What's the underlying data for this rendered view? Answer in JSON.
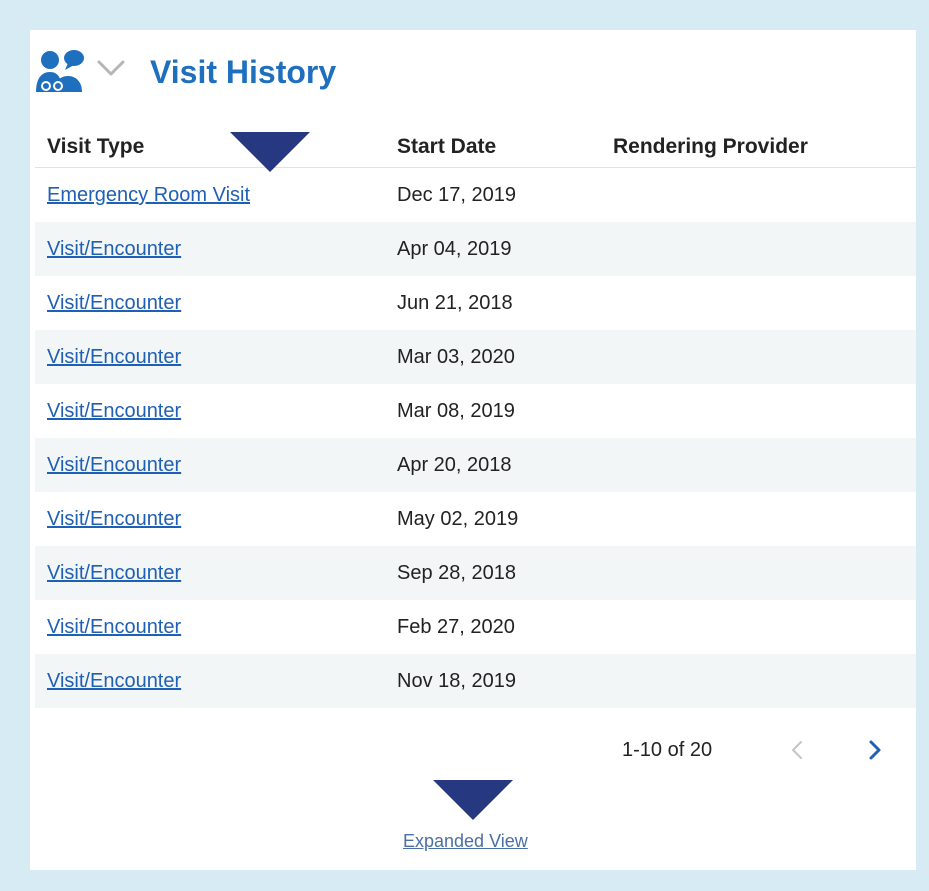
{
  "header": {
    "title": "Visit History",
    "icon": "people-chat-icon",
    "collapse_icon": "chevron-down-icon"
  },
  "table": {
    "columns": [
      "Visit Type",
      "Start Date",
      "Rendering Provider"
    ],
    "rows": [
      {
        "visit_type": "Emergency Room Visit",
        "start_date": "Dec 17, 2019",
        "provider": ""
      },
      {
        "visit_type": "Visit/Encounter",
        "start_date": "Apr 04, 2019",
        "provider": ""
      },
      {
        "visit_type": "Visit/Encounter",
        "start_date": "Jun 21, 2018",
        "provider": ""
      },
      {
        "visit_type": "Visit/Encounter",
        "start_date": "Mar 03, 2020",
        "provider": ""
      },
      {
        "visit_type": "Visit/Encounter",
        "start_date": "Mar 08, 2019",
        "provider": ""
      },
      {
        "visit_type": "Visit/Encounter",
        "start_date": "Apr 20, 2018",
        "provider": ""
      },
      {
        "visit_type": "Visit/Encounter",
        "start_date": "May 02, 2019",
        "provider": ""
      },
      {
        "visit_type": "Visit/Encounter",
        "start_date": "Sep 28, 2018",
        "provider": ""
      },
      {
        "visit_type": "Visit/Encounter",
        "start_date": "Feb 27, 2020",
        "provider": ""
      },
      {
        "visit_type": "Visit/Encounter",
        "start_date": "Nov 18, 2019",
        "provider": ""
      }
    ]
  },
  "pagination": {
    "range_text": "1-10 of 20",
    "prev_icon": "chevron-left-icon",
    "next_icon": "chevron-right-icon"
  },
  "footer": {
    "expanded_view_label": "Expanded View"
  },
  "colors": {
    "frame_background": "#d6ebf3",
    "title_blue": "#1f6fbf",
    "link_blue": "#1f5fb4",
    "marker_navy": "#263880",
    "row_shade": "#f3f6f7"
  }
}
